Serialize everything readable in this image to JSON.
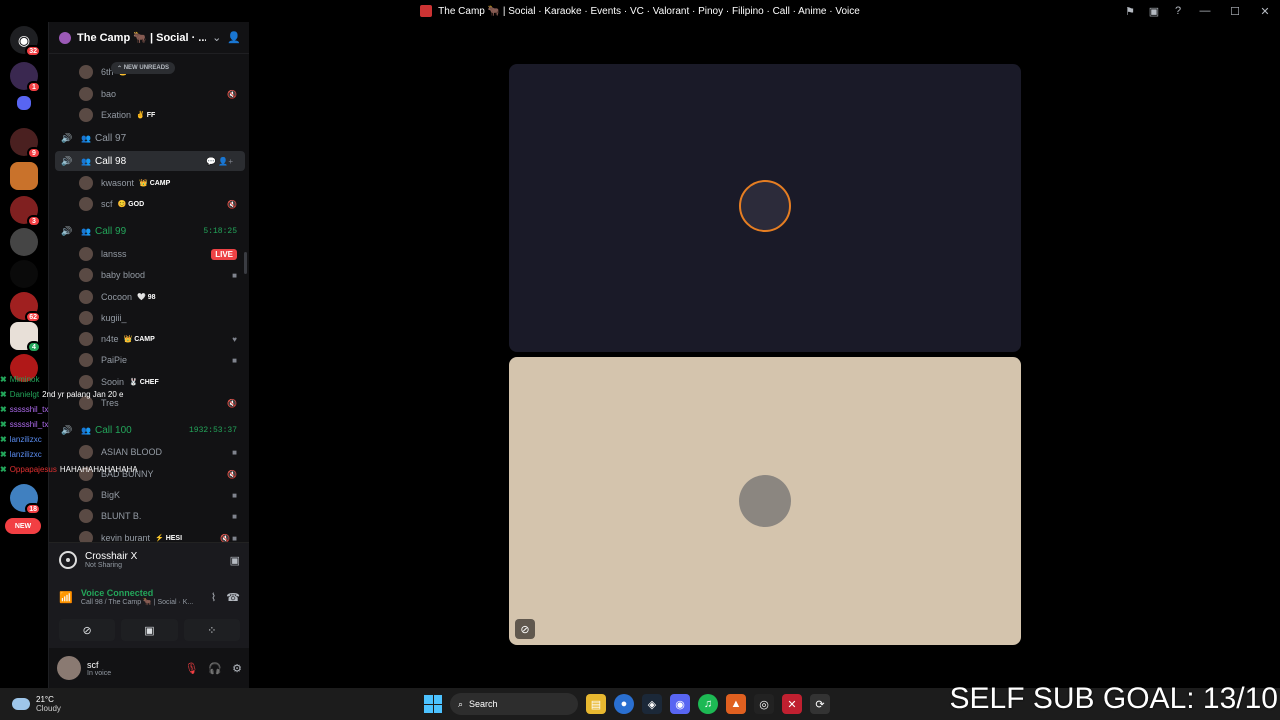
{
  "window": {
    "title": "The Camp 🐂 | Social · Karaoke · Events · VC · Valorant · Pinoy · Filipino · Call · Anime · Voice"
  },
  "guilds": {
    "badges": [
      "32",
      "1",
      "9",
      "3",
      "62",
      "4",
      "22",
      "32",
      "18",
      "19"
    ],
    "new_label": "NEW"
  },
  "server": {
    "name": "The Camp 🐂 | Social · ...",
    "new_unreads": "NEW UNREADS"
  },
  "channel_list": [
    {
      "kind": "member",
      "name": "6th",
      "tag": "👑 CAMP",
      "right": ""
    },
    {
      "kind": "member",
      "name": "bao",
      "tag": "",
      "right": "🔇"
    },
    {
      "kind": "member",
      "name": "Exation",
      "tag": "✌ FF",
      "right": ""
    },
    {
      "kind": "channel",
      "name": "Call 97",
      "right": ""
    },
    {
      "kind": "channel",
      "name": "Call 98",
      "right": "💬 👤+",
      "active": true
    },
    {
      "kind": "member",
      "name": "kwasont",
      "tag": "👑 CAMP",
      "right": ""
    },
    {
      "kind": "member",
      "name": "scf",
      "tag": "😊 GOD",
      "right": "🔇"
    },
    {
      "kind": "channel",
      "name": "Call 99",
      "right": "5:18:25",
      "timer": true
    },
    {
      "kind": "member",
      "name": "lansss",
      "tag": "",
      "right": "LIVE",
      "live": true
    },
    {
      "kind": "member",
      "name": "baby blood",
      "tag": "",
      "right": "■"
    },
    {
      "kind": "member",
      "name": "Cocoon",
      "tag": "🤍 98",
      "right": ""
    },
    {
      "kind": "member",
      "name": "kugiii_",
      "tag": "",
      "right": ""
    },
    {
      "kind": "member",
      "name": "n4te",
      "tag": "👑 CAMP",
      "right": "♥"
    },
    {
      "kind": "member",
      "name": "PaiPie",
      "tag": "",
      "right": "■"
    },
    {
      "kind": "member",
      "name": "Sooin",
      "tag": "🐰 CHEF",
      "right": ""
    },
    {
      "kind": "member",
      "name": "Tres",
      "tag": "",
      "right": "🔇"
    },
    {
      "kind": "channel",
      "name": "Call 100",
      "right": "1932:53:37",
      "timer": true
    },
    {
      "kind": "member",
      "name": "ASIAN BLOOD",
      "tag": "",
      "right": "■"
    },
    {
      "kind": "member",
      "name": "BAD BUNNY",
      "tag": "",
      "right": "🔇"
    },
    {
      "kind": "member",
      "name": "BigK",
      "tag": "",
      "right": "■"
    },
    {
      "kind": "member",
      "name": "BLUNT B.",
      "tag": "",
      "right": "■"
    },
    {
      "kind": "member",
      "name": "kevin burant",
      "tag": "⚡ HESI",
      "right": "🔇 ■"
    }
  ],
  "overlay_chat": [
    {
      "user": "Miminok",
      "msg": "",
      "color": "#23a55a"
    },
    {
      "user": "Danielgt",
      "msg": "2nd yr palang Jan 20 e",
      "color": "#23a55a"
    },
    {
      "user": "ssssshil_tx",
      "msg": "",
      "color": "#b06cf0"
    },
    {
      "user": "ssssshil_tx",
      "msg": "",
      "color": "#b06cf0"
    },
    {
      "user": "lanzilizxc",
      "msg": "",
      "color": "#5a8cf0"
    },
    {
      "user": "lanzilizxc",
      "msg": "",
      "color": "#5a8cf0"
    },
    {
      "user": "Oppapajesus",
      "msg": "HAHAHAHAHAHAHA",
      "color": "#e03030"
    }
  ],
  "panel": {
    "crosshair_title": "Crosshair X",
    "crosshair_sub": "Not Sharing",
    "voice_status": "Voice Connected",
    "voice_channel": "Call 98 / The Camp 🐂 | Social · K...",
    "user_name": "scf",
    "user_status": "In voice"
  },
  "taskbar": {
    "temp": "21°C",
    "weather": "Cloudy",
    "search": "Search",
    "overlay_text": "SELF SUB GOAL: 13/10"
  },
  "colors": {
    "accent": "#23a55a",
    "danger": "#f23f43",
    "bg": "#121214"
  }
}
